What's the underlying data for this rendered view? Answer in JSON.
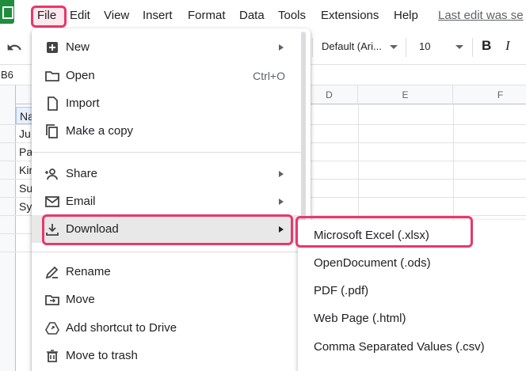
{
  "menubar": {
    "items": [
      "File",
      "Edit",
      "View",
      "Insert",
      "Format",
      "Data",
      "Tools",
      "Extensions",
      "Help"
    ],
    "last_edit": "Last edit was se"
  },
  "toolbar": {
    "font": "Default (Ari...",
    "font_size": "10",
    "bold": "B",
    "italic": "I"
  },
  "formula_bar": {
    "name_box": "B6"
  },
  "grid": {
    "columns": [
      "D",
      "E",
      "F"
    ],
    "col_a_cells": [
      "Na",
      "Ju",
      "Pa",
      "Kir",
      "Su",
      "Sy"
    ]
  },
  "file_menu": {
    "items": [
      {
        "label": "New",
        "submenu": true
      },
      {
        "label": "Open",
        "shortcut": "Ctrl+O"
      },
      {
        "label": "Import"
      },
      {
        "label": "Make a copy"
      },
      {
        "label": "Share",
        "submenu": true
      },
      {
        "label": "Email",
        "submenu": true
      },
      {
        "label": "Download",
        "submenu": true
      },
      {
        "label": "Rename"
      },
      {
        "label": "Move"
      },
      {
        "label": "Add shortcut to Drive"
      },
      {
        "label": "Move to trash"
      }
    ]
  },
  "download_submenu": {
    "items": [
      "Microsoft Excel (.xlsx)",
      "OpenDocument (.ods)",
      "PDF (.pdf)",
      "Web Page (.html)",
      "Comma Separated Values (.csv)"
    ]
  },
  "colors": {
    "highlight": "#e8386b",
    "sheets_green": "#1e8e3e"
  }
}
